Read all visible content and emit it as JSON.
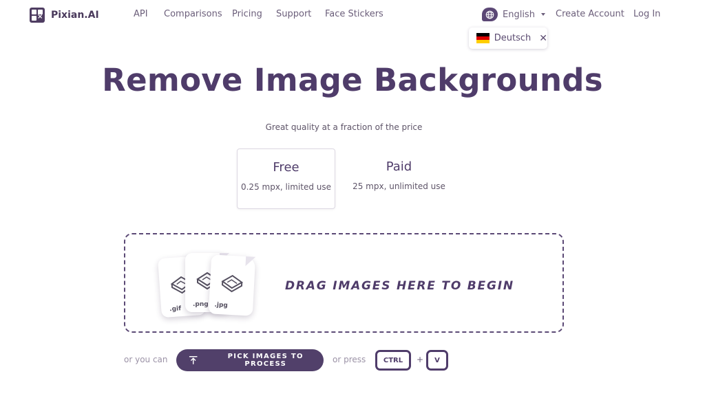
{
  "brand": {
    "name": "Pixian.AI"
  },
  "nav": {
    "items": [
      "API",
      "Comparisons",
      "Pricing",
      "Support",
      "Face Stickers"
    ]
  },
  "language": {
    "current": "English",
    "suggestion": "Deutsch",
    "flag_colors": [
      "#000000",
      "#dd0000",
      "#ffce00"
    ]
  },
  "account": {
    "create": "Create Account",
    "login": "Log In"
  },
  "hero": {
    "title": "Remove Image Backgrounds",
    "subtitle": "Great quality at a fraction of the price"
  },
  "plans": [
    {
      "name": "Free",
      "desc": "0.25 mpx, limited use",
      "selected": true
    },
    {
      "name": "Paid",
      "desc": "25 mpx, unlimited use",
      "selected": false
    }
  ],
  "dropzone": {
    "text": "DRAG IMAGES HERE TO BEGIN",
    "file_types": [
      ".gif",
      ".png",
      ".jpg"
    ]
  },
  "actions": {
    "or_you_can": "or you can",
    "pick_button": "PICK IMAGES TO PROCESS",
    "or_press": "or press",
    "key1": "CTRL",
    "plus": "+",
    "key2": "V"
  },
  "colors": {
    "primary": "#51406a",
    "text": "#4f3c6a",
    "muted": "#9b92a6"
  }
}
